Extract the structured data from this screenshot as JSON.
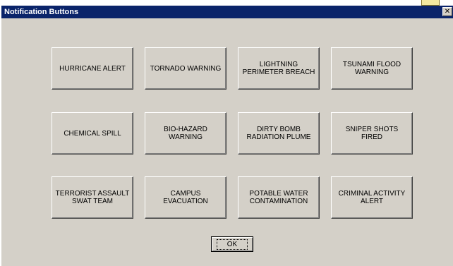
{
  "window": {
    "title": "Notification Buttons",
    "close_glyph": "✕"
  },
  "buttons": [
    {
      "label": "HURRICANE ALERT"
    },
    {
      "label": "TORNADO WARNING"
    },
    {
      "label": "LIGHTNING PERIMETER BREACH"
    },
    {
      "label": "TSUNAMI FLOOD WARNING"
    },
    {
      "label": "CHEMICAL SPILL"
    },
    {
      "label": "BIO-HAZARD WARNING"
    },
    {
      "label": "DIRTY BOMB RADIATION PLUME"
    },
    {
      "label": "SNIPER SHOTS FIRED"
    },
    {
      "label": "TERRORIST ASSAULT SWAT TEAM"
    },
    {
      "label": "CAMPUS EVACUATION"
    },
    {
      "label": "POTABLE WATER CONTAMINATION"
    },
    {
      "label": "CRIMINAL ACTIVITY ALERT"
    }
  ],
  "ok": {
    "label": "OK"
  },
  "colors": {
    "title_bar": "#0a246a",
    "face": "#d4d0c8",
    "title_text": "#ffffff"
  }
}
